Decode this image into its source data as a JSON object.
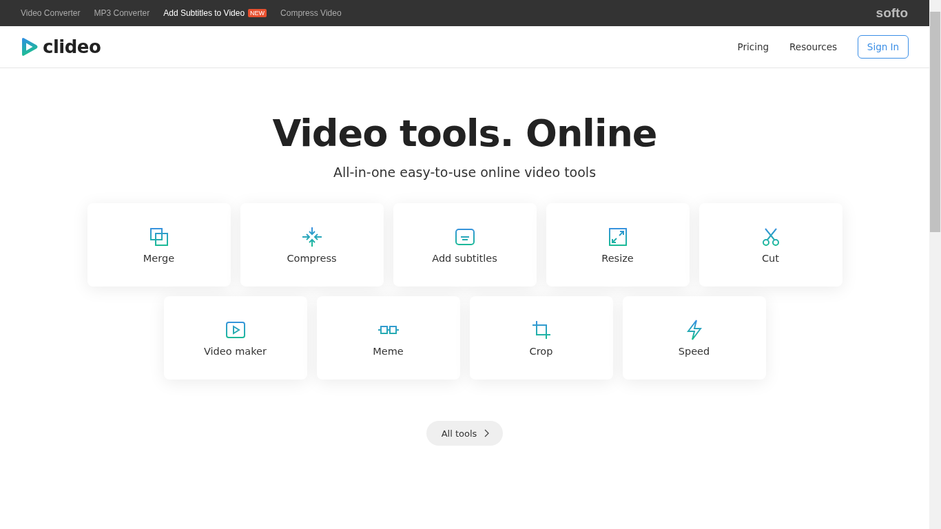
{
  "top_bar": {
    "links": [
      {
        "label": "Video Converter",
        "selected": false
      },
      {
        "label": "MP3 Converter",
        "selected": false
      },
      {
        "label": "Add Subtitles to Video",
        "selected": true,
        "badge": "NEW"
      },
      {
        "label": "Compress Video",
        "selected": false
      }
    ],
    "brand": "softo"
  },
  "header": {
    "logo": "clideo",
    "nav": [
      "Pricing",
      "Resources"
    ],
    "sign_in": "Sign In"
  },
  "hero": {
    "title": "Video tools. Online",
    "subtitle": "All-in-one easy-to-use online video tools"
  },
  "tool_rows": [
    [
      {
        "label": "Merge",
        "kind": "merge"
      },
      {
        "label": "Compress",
        "kind": "compress"
      },
      {
        "label": "Add subtitles",
        "kind": "subtitles"
      },
      {
        "label": "Resize",
        "kind": "resize"
      },
      {
        "label": "Cut",
        "kind": "cut"
      }
    ],
    [
      {
        "label": "Video maker",
        "kind": "video"
      },
      {
        "label": "Meme",
        "kind": "meme"
      },
      {
        "label": "Crop",
        "kind": "crop"
      },
      {
        "label": "Speed",
        "kind": "speed"
      }
    ]
  ],
  "all_tools": "All tools"
}
